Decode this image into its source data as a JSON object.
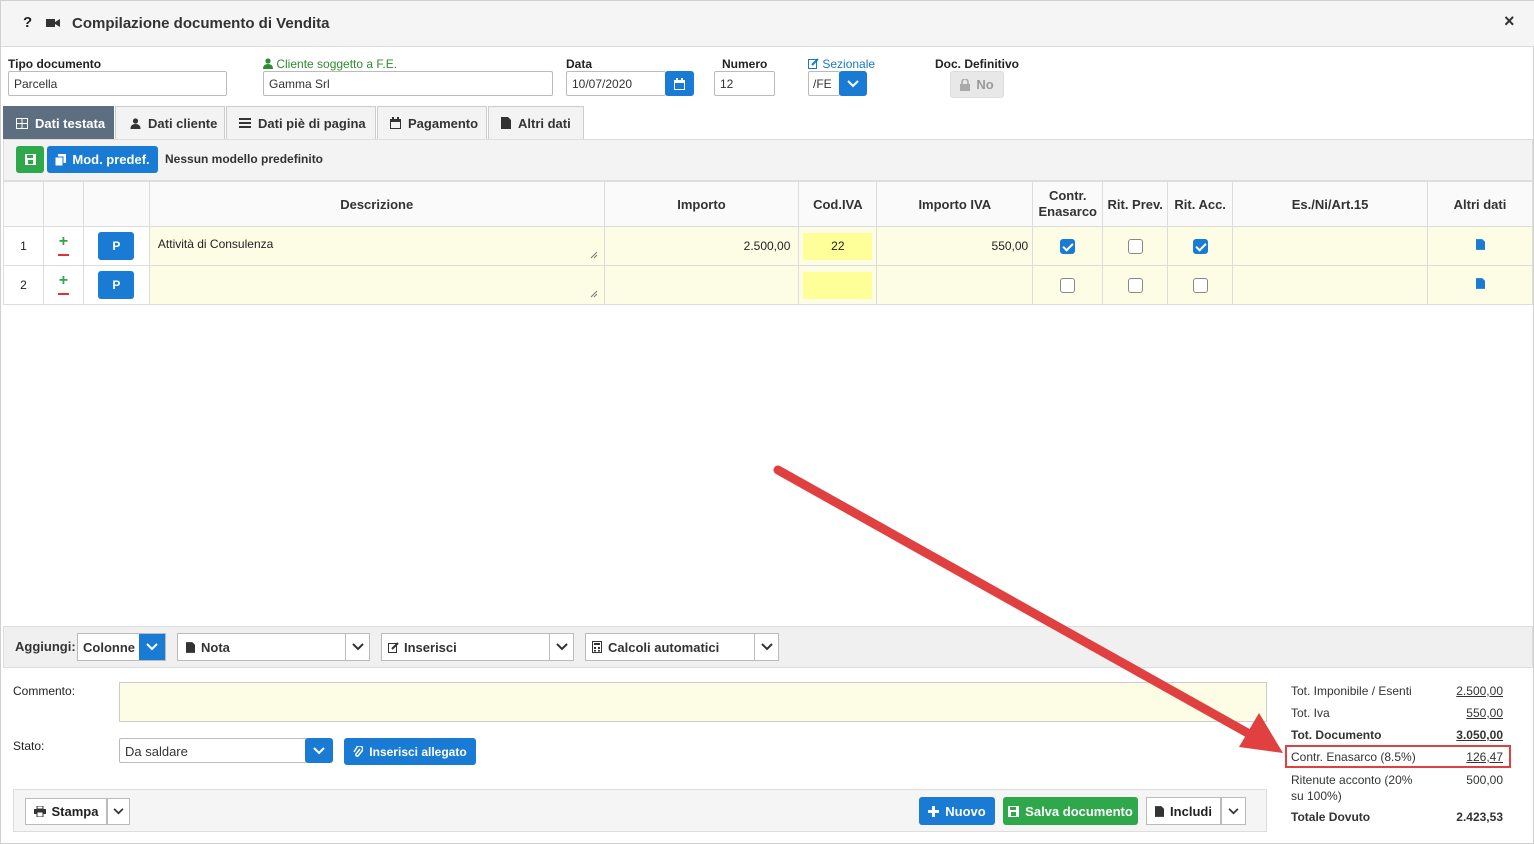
{
  "window": {
    "help": "?",
    "title": "Compilazione documento di Vendita",
    "close": "×"
  },
  "form": {
    "tipo_label": "Tipo documento",
    "tipo_value": "Parcella",
    "cliente_label": "Cliente soggetto a F.E.",
    "cliente_value": "Gamma Srl",
    "data_label": "Data",
    "data_value": "10/07/2020",
    "numero_label": "Numero",
    "numero_value": "12",
    "sezionale_label": "Sezionale",
    "sezionale_value": "/FE",
    "definitivo_label": "Doc. Definitivo",
    "definitivo_value": "No"
  },
  "tabs": [
    "Dati testata",
    "Dati cliente",
    "Dati piè di pagina",
    "Pagamento",
    "Altri dati"
  ],
  "toolbar": {
    "mod_label": "Mod. predef.",
    "model_text": "Nessun modello predefinito"
  },
  "grid": {
    "headers": {
      "descrizione": "Descrizione",
      "importo": "Importo",
      "cod_iva": "Cod.IVA",
      "importo_iva": "Importo IVA",
      "contr_l1": "Contr.",
      "contr_l2": "Enasarco",
      "rit_prev": "Rit. Prev.",
      "rit_acc": "Rit. Acc.",
      "es": "Es./Ni/Art.15",
      "altri": "Altri dati"
    },
    "rows": [
      {
        "n": "1",
        "p": "P",
        "descrizione": "Attività di Consulenza",
        "importo": "2.500,00",
        "cod_iva": "22",
        "importo_iva": "550,00",
        "contr": true,
        "rit_prev": false,
        "rit_acc": true
      },
      {
        "n": "2",
        "p": "P",
        "descrizione": "",
        "importo": "",
        "cod_iva": "",
        "importo_iva": "",
        "contr": false,
        "rit_prev": false,
        "rit_acc": false
      }
    ]
  },
  "aggiungi": {
    "label": "Aggiungi:",
    "colonne": "Colonne",
    "nota": "Nota",
    "inserisci": "Inserisci",
    "calcoli": "Calcoli automatici"
  },
  "footer": {
    "commento_label": "Commento:",
    "stato_label": "Stato:",
    "stato_value": "Da saldare",
    "allegato": "Inserisci allegato",
    "stampa": "Stampa",
    "nuovo": "Nuovo",
    "salva": "Salva documento",
    "includi": "Includi"
  },
  "totals": {
    "imponibile_label": "Tot. Imponibile / Esenti",
    "imponibile": "2.500,00",
    "iva_label": "Tot. Iva",
    "iva": "550,00",
    "documento_label": "Tot. Documento",
    "documento": "3.050,00",
    "enasarco_label": "Contr. Enasarco (8.5%)",
    "enasarco": "126,47",
    "ritenute_label_l1": "Ritenute acconto (20%",
    "ritenute_label_l2": "su 100%)",
    "ritenute": "500,00",
    "dovuto_label": "Totale Dovuto",
    "dovuto": "2.423,53"
  },
  "colors": {
    "accent": "#1a7bd4",
    "green": "#2ea84a",
    "tab_active": "#5c6e80",
    "highlight": "#e04040"
  }
}
